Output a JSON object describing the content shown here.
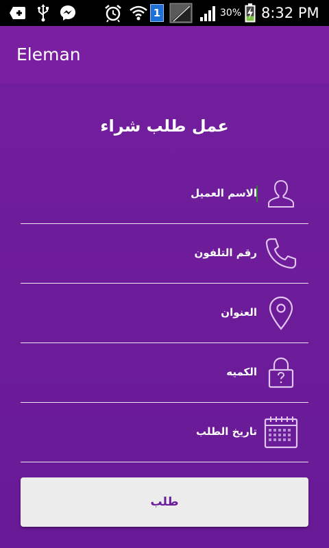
{
  "status_bar": {
    "icons": [
      "add-icon",
      "usb-icon",
      "messenger-icon",
      "alarm-icon",
      "wifi-icon",
      "sim-1-badge",
      "no-signal-icon",
      "signal-icon",
      "battery-charging-icon"
    ],
    "sim_number": "1",
    "battery_percent": "30%",
    "time": "8:32 PM"
  },
  "appbar": {
    "title": "Eleman"
  },
  "form": {
    "title": "عمل طلب شراء",
    "fields": [
      {
        "label": "الاسم العميل",
        "icon": "user-icon",
        "focused": true
      },
      {
        "label": "رقم التلفون",
        "icon": "phone-icon"
      },
      {
        "label": "العنوان",
        "icon": "location-pin-icon"
      },
      {
        "label": "الكميه",
        "icon": "lock-question-icon"
      },
      {
        "label": "تاريخ الطلب",
        "icon": "calendar-icon"
      }
    ],
    "submit_label": "طلب"
  },
  "colors": {
    "statusbar": "#000000",
    "appbar": "#7b1fa2",
    "background": "#6a1b9a",
    "button_bg": "#ececec",
    "button_text": "#6a1b9a",
    "caret": "#2e7d32"
  }
}
